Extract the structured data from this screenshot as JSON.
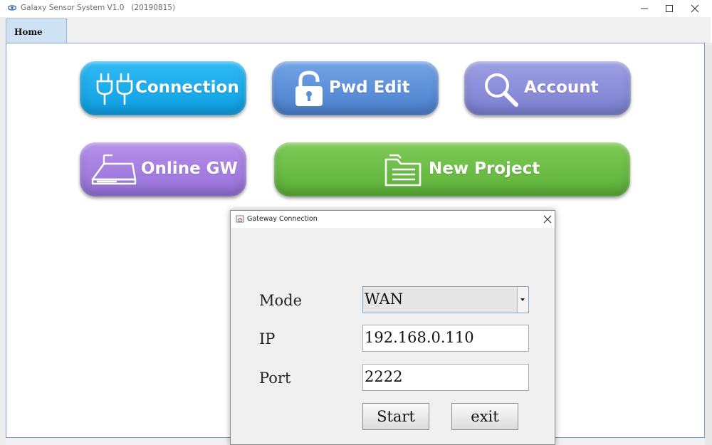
{
  "window": {
    "title": "Galaxy Sensor System V1.0   (20190815)",
    "icon": "galaxy-logo-icon",
    "controls": [
      "minimize-icon",
      "maximize-icon",
      "close-icon"
    ]
  },
  "tabs": [
    {
      "label": "Home",
      "selected": true
    }
  ],
  "main_buttons": [
    {
      "label": "Connection",
      "icon": "plug-icon",
      "color": "#16a8ec"
    },
    {
      "label": "Pwd Edit",
      "icon": "unlock-icon",
      "color": "#5b8fd8"
    },
    {
      "label": "Account",
      "icon": "search-icon",
      "color": "#8a8ed8"
    },
    {
      "label": "Online GW",
      "icon": "gateway-device-icon",
      "color": "#a27ee0"
    },
    {
      "label": "New Project",
      "icon": "folder-icon",
      "color": "#6fc04a"
    }
  ],
  "dialog": {
    "title": "Gateway Connection",
    "mode_label": "Mode",
    "mode_value": "WAN",
    "ip_label": "IP",
    "ip_value": "192.168.0.110",
    "port_label": "Port",
    "port_value": "2222",
    "start_label": "Start",
    "exit_label": "exit"
  }
}
